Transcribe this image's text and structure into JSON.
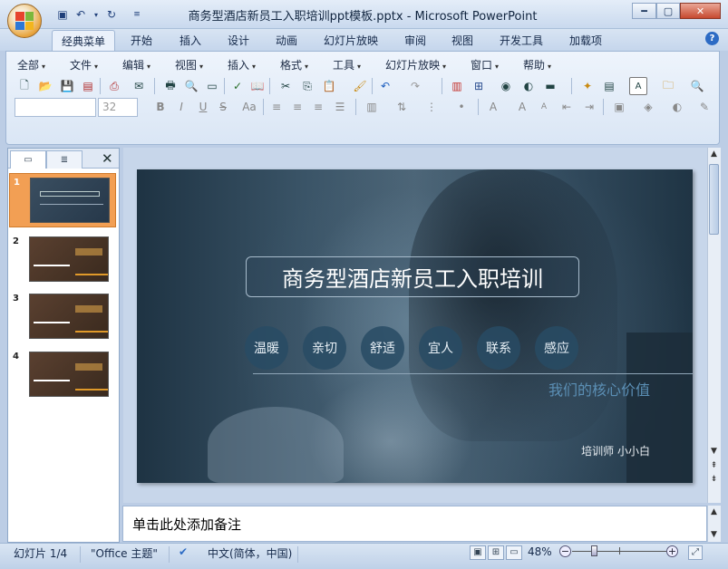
{
  "window": {
    "title": "商务型酒店新员工入职培训ppt模板.pptx - Microsoft PowerPoint"
  },
  "ribbon_tabs": [
    "经典菜单",
    "开始",
    "插入",
    "设计",
    "动画",
    "幻灯片放映",
    "审阅",
    "视图",
    "开发工具",
    "加载项"
  ],
  "menu_items": [
    "全部",
    "文件",
    "编辑",
    "视图",
    "插入",
    "格式",
    "工具",
    "幻灯片放映",
    "窗口",
    "帮助"
  ],
  "font_size": "32",
  "slide": {
    "title": "商务型酒店新员工入职培训",
    "values": [
      "温暖",
      "亲切",
      "舒适",
      "宜人",
      "联系",
      "感应"
    ],
    "core_values_label": "我们的核心价值",
    "trainer": "培训师 小小白"
  },
  "thumbnails": [
    "1",
    "2",
    "3",
    "4"
  ],
  "notes_placeholder": "单击此处添加备注",
  "status": {
    "slide_indicator": "幻灯片 1/4",
    "theme": "\"Office 主题\"",
    "language": "中文(简体，中国)",
    "zoom": "48%"
  },
  "colors": {
    "accent_tab": "#eaf1fb",
    "selected_thumb": "#f29f54",
    "slide_bg": "#2f4a5e",
    "core_values_text": "#5b8fb5"
  }
}
